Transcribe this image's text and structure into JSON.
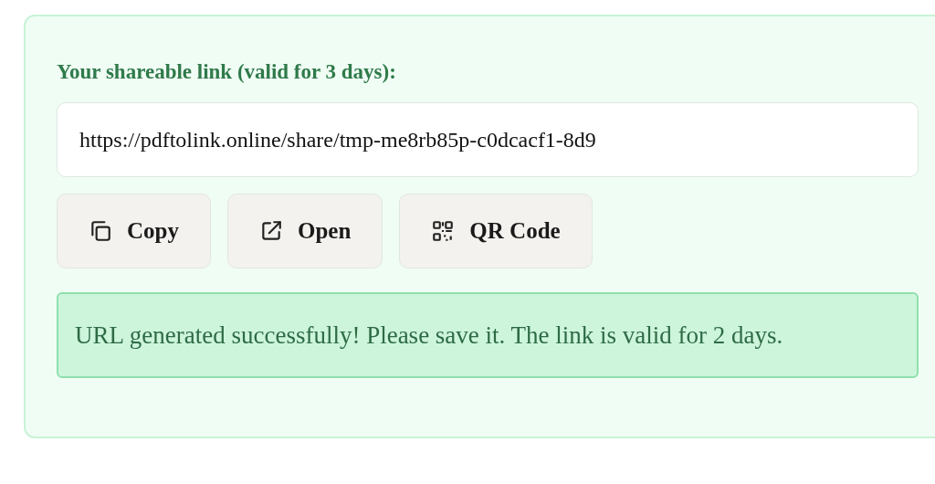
{
  "label": "Your shareable link (valid for 3 days):",
  "link_field": {
    "value": "https://pdftolink.online/share/tmp-me8rb85p-c0dcacf1-8d9"
  },
  "buttons": [
    {
      "label": "Copy",
      "kind": "copy"
    },
    {
      "label": "Open",
      "kind": "open"
    },
    {
      "label": "QR Code",
      "kind": "qr"
    }
  ],
  "message": "URL generated successfully! Please save it. The link is valid for 2 days."
}
